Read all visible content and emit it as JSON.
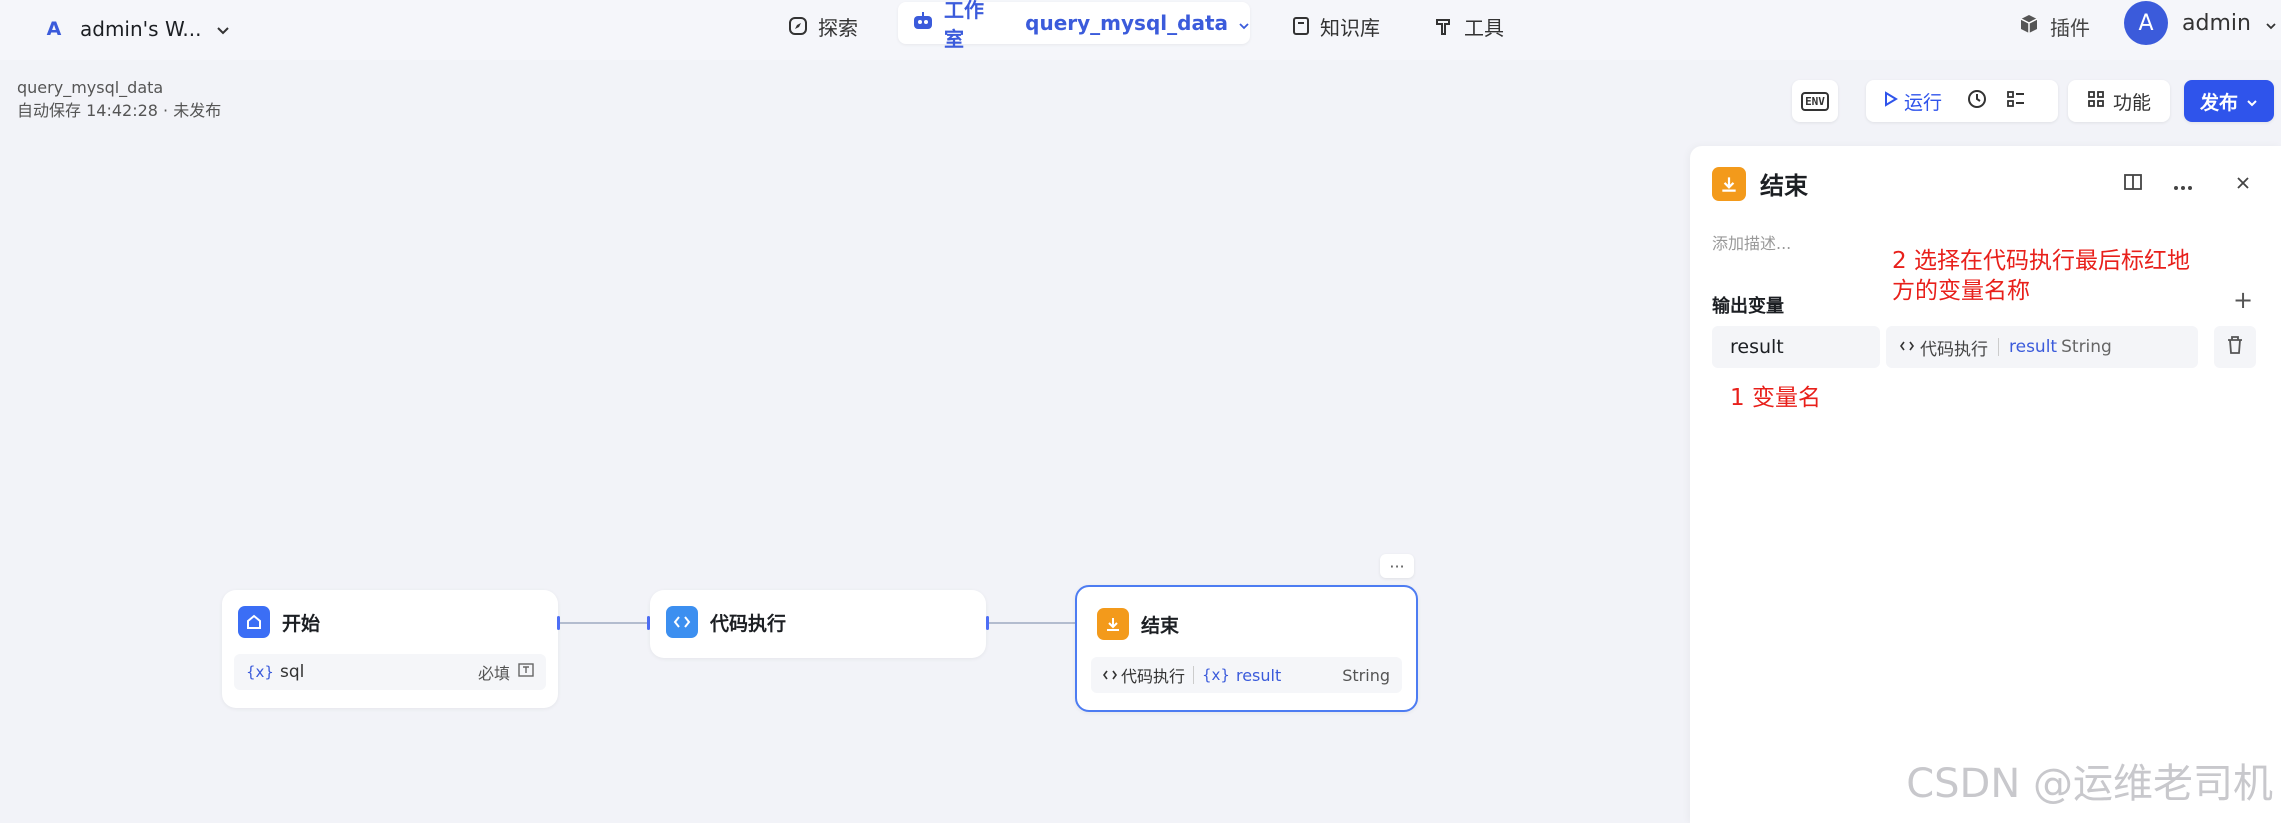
{
  "topbar": {
    "workspace_logo": "A",
    "workspace_name": "admin's W...",
    "explore": "探索",
    "studio": "工作室",
    "workflow_name": "query_mysql_data",
    "knowledge": "知识库",
    "tools": "工具",
    "plugins": "插件",
    "avatar_letter": "A",
    "user": "admin"
  },
  "header": {
    "title": "query_mysql_data",
    "autosave": "自动保存 14:42:28 · 未发布"
  },
  "toolbar": {
    "env": "ENV",
    "run": "运行",
    "features": "功能",
    "publish": "发布"
  },
  "nodes": {
    "start": {
      "title": "开始",
      "var_prefix": "{x}",
      "var_name": "sql",
      "required": "必填"
    },
    "code": {
      "title": "代码执行"
    },
    "end": {
      "title": "结束",
      "ref_source": "代码执行",
      "var_prefix": "{x}",
      "ref_var": "result",
      "ref_type": "String",
      "more": "···"
    }
  },
  "panel": {
    "title": "结束",
    "description_placeholder": "添加描述...",
    "output_label": "输出变量",
    "var_name": "result",
    "ref_source": "代码执行",
    "ref_var": "result",
    "ref_type": "String",
    "annotation1": "1 变量名",
    "annotation2_line1": "2 选择在代码执行最后标红地",
    "annotation2_line2": "方的变量名称"
  },
  "watermark": "CSDN @运维老司机",
  "colors": {
    "accent": "#3b5bdb",
    "publish": "#2f54eb",
    "end_icon": "#f39a1b",
    "annotation": "#e8201b"
  }
}
